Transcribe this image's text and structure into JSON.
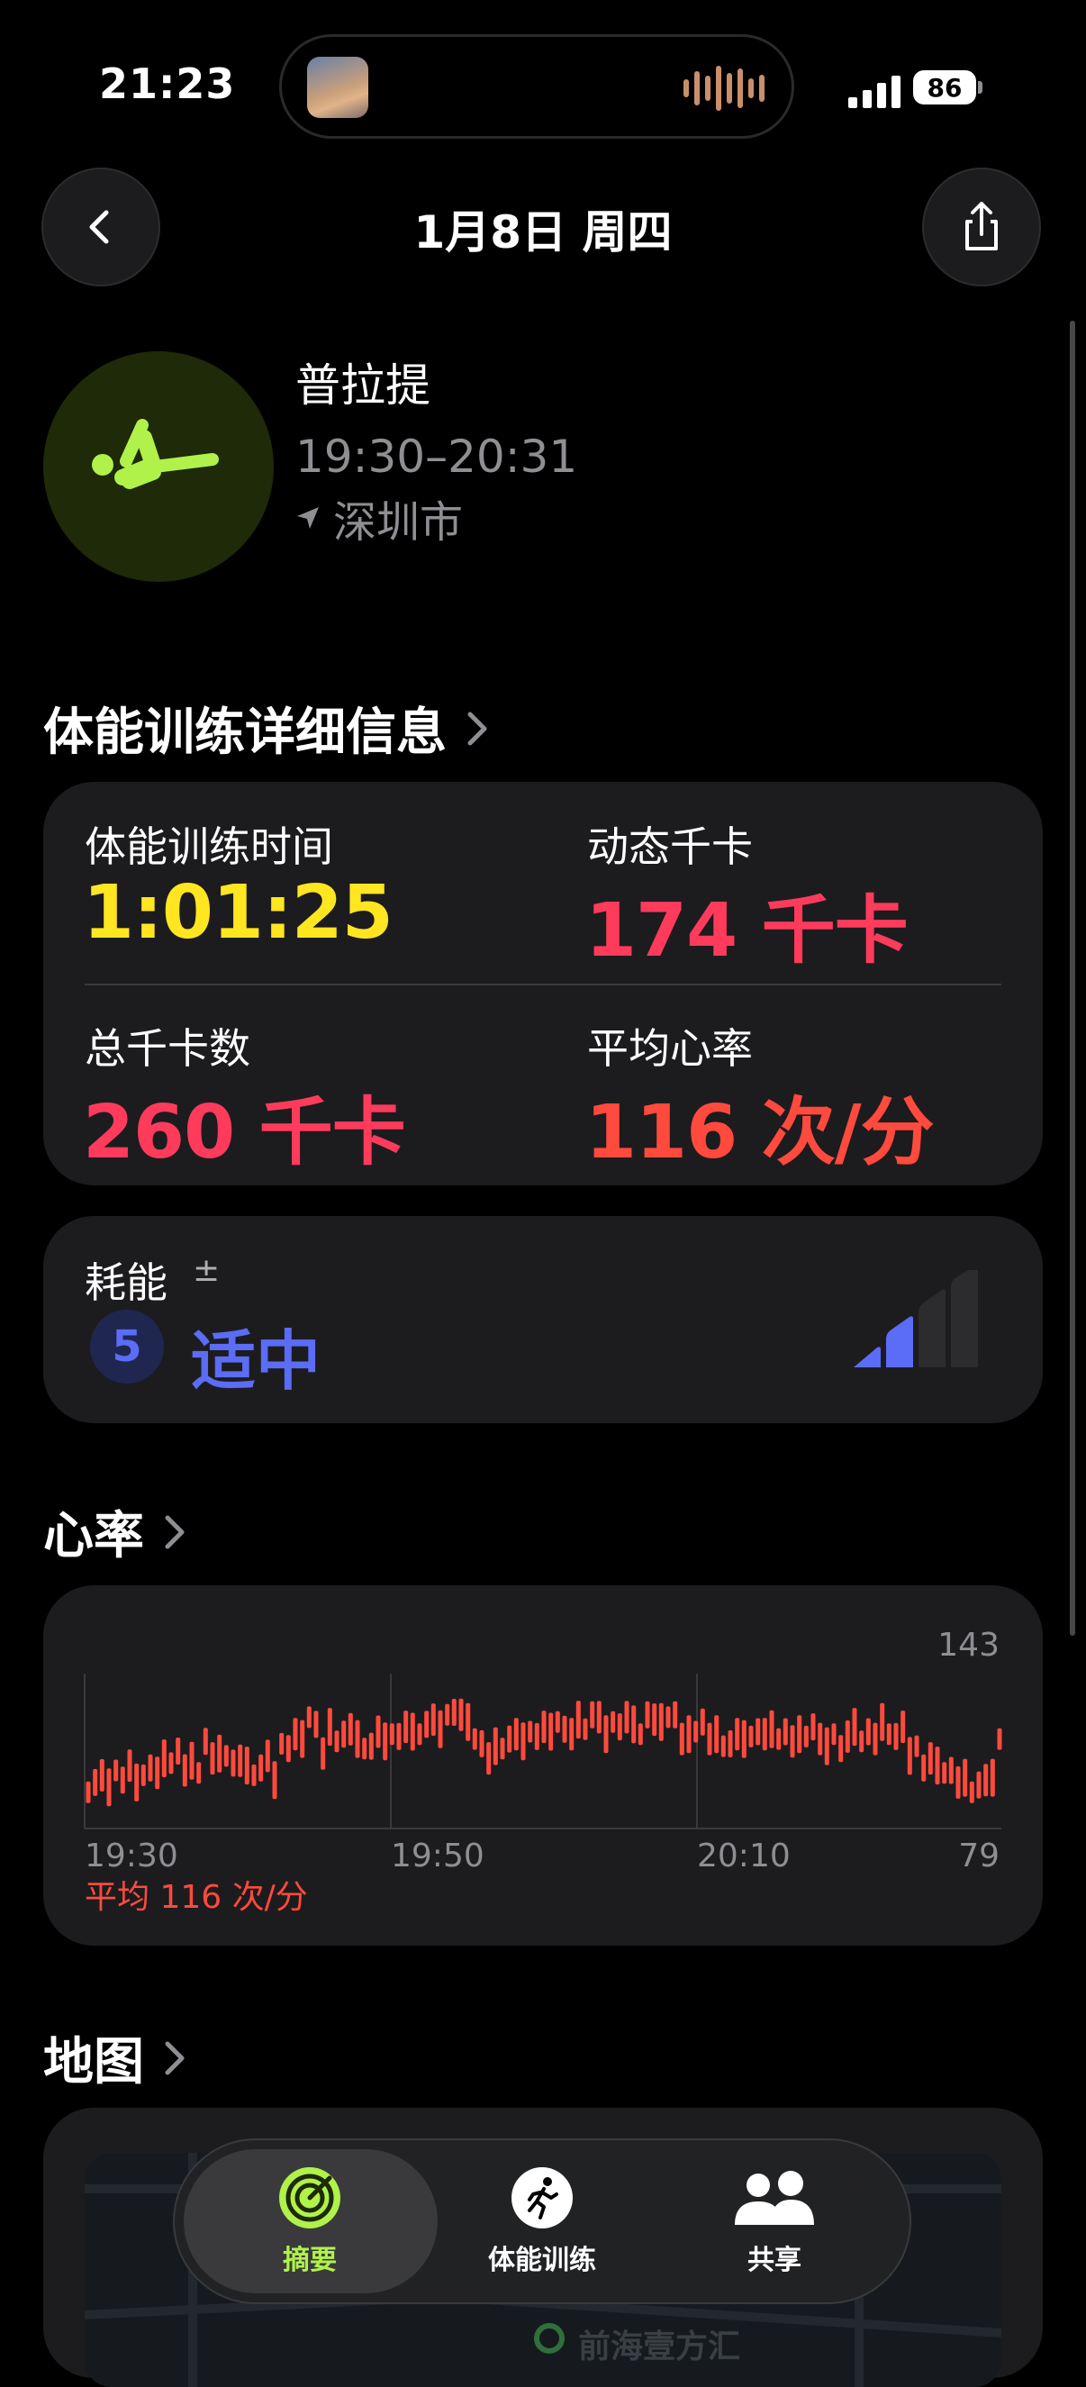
{
  "status": {
    "time": "21:23",
    "battery": "86"
  },
  "nav": {
    "title": "1月8日 周四"
  },
  "workout": {
    "name": "普拉提",
    "time_range": "19:30–20:31",
    "location": "深圳市"
  },
  "details": {
    "title": "体能训练详细信息",
    "metrics": [
      {
        "label": "体能训练时间",
        "value": "1:01:25"
      },
      {
        "label": "动态千卡",
        "value": "174 千卡"
      },
      {
        "label": "总千卡数",
        "value": "260 千卡"
      },
      {
        "label": "平均心率",
        "value": "116 次/分"
      }
    ]
  },
  "effort": {
    "label": "耗能",
    "symbol": "±",
    "level": "5",
    "text": "适中",
    "bars_total": 4,
    "bars_filled": 2
  },
  "heart_rate": {
    "title": "心率",
    "average_label": "平均 116 次/分"
  },
  "chart_data": {
    "type": "bar",
    "x_ticks": [
      "19:30",
      "19:50",
      "20:10"
    ],
    "max_label": "143",
    "min_label": "79",
    "ylim": [
      79,
      143
    ],
    "values": [
      94,
      98,
      101,
      96,
      103,
      99,
      105,
      98,
      101,
      104,
      102,
      108,
      106,
      111,
      103,
      107,
      102,
      115,
      108,
      110,
      109,
      106,
      107,
      105,
      101,
      104,
      109,
      99,
      114,
      112,
      118,
      116,
      125,
      122,
      110,
      121,
      115,
      118,
      120,
      116,
      112,
      113,
      119,
      115,
      118,
      117,
      121,
      119,
      118,
      122,
      124,
      120,
      126,
      127,
      126,
      123,
      116,
      114,
      108,
      113,
      112,
      116,
      118,
      115,
      119,
      117,
      121,
      119,
      123,
      120,
      118,
      124,
      120,
      126,
      125,
      118,
      123,
      121,
      125,
      122,
      118,
      126,
      124,
      123,
      125,
      126,
      116,
      118,
      119,
      123,
      116,
      118,
      113,
      114,
      118,
      116,
      117,
      119,
      118,
      120,
      116,
      119,
      115,
      118,
      117,
      121,
      116,
      113,
      118,
      112,
      117,
      121,
      115,
      119,
      116,
      123,
      118,
      117,
      121,
      109,
      113,
      104,
      108,
      105,
      102,
      103,
      98,
      100,
      94,
      97,
      99,
      100,
      116
    ]
  },
  "map": {
    "title": "地图",
    "poi": "前海壹方汇"
  },
  "tabs": [
    {
      "label": "摘要",
      "icon": "activity-rings-icon",
      "active": true
    },
    {
      "label": "体能训练",
      "icon": "running-figure-icon",
      "active": false
    },
    {
      "label": "共享",
      "icon": "people-icon",
      "active": false
    }
  ],
  "colors": {
    "yellow": "#ffe620",
    "red": "#ff3b5c",
    "orange": "#ff4a3d",
    "blue": "#5b6cf6",
    "green": "#b0f24a"
  }
}
